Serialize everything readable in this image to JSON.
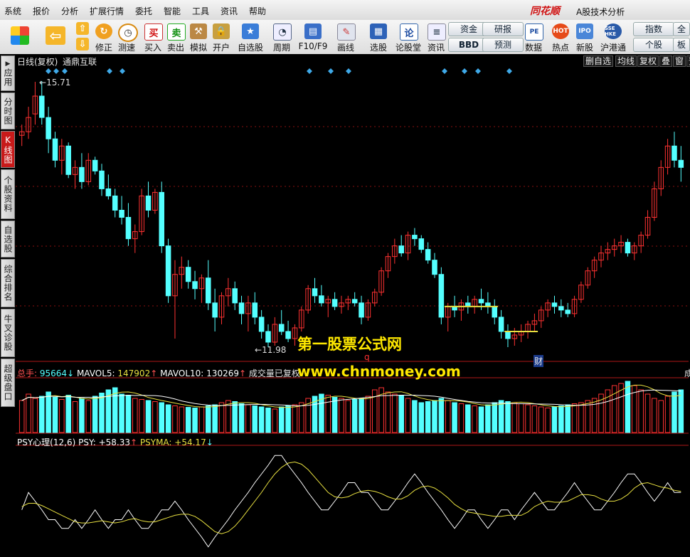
{
  "menu": {
    "items": [
      "系统",
      "报价",
      "分析",
      "扩展行情",
      "委托",
      "智能",
      "工具",
      "资讯",
      "帮助"
    ],
    "brand": "同花顺",
    "app_title": "A股技术分析"
  },
  "toolbar": {
    "buttons": [
      {
        "label": "修正",
        "icon": "up-arrow-icon"
      },
      {
        "label": "测速",
        "icon": "clock-icon"
      },
      {
        "label": "买入",
        "icon": "buy-icon"
      },
      {
        "label": "卖出",
        "icon": "sell-icon"
      },
      {
        "label": "模拟",
        "icon": "hammer-icon"
      },
      {
        "label": "开户",
        "icon": "lock-icon"
      },
      {
        "label": "自选股",
        "icon": "star-icon"
      },
      {
        "label": "周期",
        "icon": "period-icon"
      },
      {
        "label": "F10/F9",
        "icon": "f10-icon"
      },
      {
        "label": "画线",
        "icon": "pen-icon"
      },
      {
        "label": "选股",
        "icon": "screen-icon"
      },
      {
        "label": "论股堂",
        "icon": "forum-icon"
      },
      {
        "label": "资讯",
        "icon": "news-icon"
      },
      {
        "label": "数据",
        "icon": "pe-icon"
      },
      {
        "label": "热点",
        "icon": "hot-icon"
      },
      {
        "label": "新股",
        "icon": "ipo-icon"
      },
      {
        "label": "沪港通",
        "icon": "sse-hkex-icon"
      }
    ],
    "small": [
      {
        "label": "资金"
      },
      {
        "label": "BBD"
      },
      {
        "label": "研报"
      },
      {
        "label": "预测"
      },
      {
        "label": "指数"
      },
      {
        "label": "个股"
      },
      {
        "label": "全球"
      },
      {
        "label": "板块"
      }
    ]
  },
  "side_tabs": [
    "应用",
    "分时图",
    "K线图",
    "个股资料",
    "自选股",
    "综合排名",
    "牛叉诊股",
    "超级盘口"
  ],
  "chart_header": {
    "period": "日线(复权)",
    "stock_name": "通鼎互联",
    "right_buttons": [
      "删自选",
      "均线",
      "复权",
      "叠",
      "窗",
      "预"
    ]
  },
  "price": {
    "high_label": "15.71",
    "low_label": "11.98"
  },
  "markers": {
    "q": "q",
    "cai": "财"
  },
  "volume_panel": {
    "title": "总手:",
    "total": "95664",
    "total_arrow": "↓",
    "mavol5_label": "MAVOL5:",
    "mavol5": "147902",
    "mavol5_arrow": "↑",
    "mavol10_label": "MAVOL10:",
    "mavol10": "130269",
    "mavol10_arrow": "↑",
    "note": "成交量已复权",
    "right_label": "成"
  },
  "psy_panel": {
    "title": "PSY心理(12,6)",
    "psy_label": "PSY:",
    "psy": "+58.33",
    "psy_arrow": "↑",
    "psyma_label": "PSYMA:",
    "psyma": "+54.17",
    "psyma_arrow": "↓"
  },
  "watermark": {
    "line1": "第一股票公式网",
    "line2": "www.chnmoney.com"
  },
  "colors": {
    "up": "#ff3232",
    "down": "#54ffff",
    "ma_yellow": "#e8e040",
    "bg": "#000000",
    "grid": "#8a1010",
    "diamond": "#3fa9e8",
    "watermark": "#ffe800"
  },
  "chart_data": {
    "type": "candlestick",
    "price_range": [
      11.98,
      15.71
    ],
    "psy_range": [
      0,
      100
    ],
    "candles": [
      [
        14.95,
        15.1,
        14.8,
        15.0
      ],
      [
        15.0,
        15.35,
        14.9,
        15.2
      ],
      [
        15.25,
        15.7,
        15.1,
        15.5
      ],
      [
        15.5,
        15.71,
        15.1,
        15.2
      ],
      [
        15.2,
        15.35,
        14.7,
        14.9
      ],
      [
        14.9,
        15.0,
        14.5,
        14.6
      ],
      [
        14.6,
        14.9,
        14.4,
        14.8
      ],
      [
        14.8,
        14.85,
        14.35,
        14.4
      ],
      [
        14.4,
        14.6,
        14.2,
        14.5
      ],
      [
        14.5,
        14.7,
        14.2,
        14.3
      ],
      [
        14.3,
        14.7,
        14.25,
        14.6
      ],
      [
        14.6,
        14.65,
        14.4,
        14.45
      ],
      [
        14.45,
        14.55,
        14.1,
        14.2
      ],
      [
        14.2,
        14.4,
        14.05,
        14.1
      ],
      [
        14.1,
        14.2,
        13.8,
        13.9
      ],
      [
        13.9,
        14.1,
        13.7,
        13.8
      ],
      [
        13.8,
        14.0,
        13.4,
        13.5
      ],
      [
        13.5,
        13.7,
        13.3,
        13.6
      ],
      [
        13.6,
        14.2,
        13.55,
        14.1
      ],
      [
        14.1,
        14.3,
        13.8,
        13.9
      ],
      [
        13.9,
        14.2,
        13.85,
        14.15
      ],
      [
        14.15,
        14.3,
        13.3,
        13.4
      ],
      [
        13.4,
        13.5,
        12.6,
        12.7
      ],
      [
        12.7,
        13.2,
        12.1,
        13.0
      ],
      [
        13.0,
        13.25,
        12.8,
        13.1
      ],
      [
        13.1,
        13.2,
        12.8,
        12.9
      ],
      [
        12.9,
        13.05,
        12.65,
        12.8
      ],
      [
        12.8,
        13.0,
        12.6,
        12.95
      ],
      [
        12.95,
        13.2,
        12.5,
        12.6
      ],
      [
        12.6,
        12.8,
        12.2,
        12.4
      ],
      [
        12.4,
        12.75,
        12.3,
        12.7
      ],
      [
        12.7,
        12.95,
        12.55,
        12.8
      ],
      [
        12.8,
        12.9,
        12.5,
        12.6
      ],
      [
        12.6,
        12.7,
        12.3,
        12.45
      ],
      [
        12.45,
        12.7,
        12.2,
        12.6
      ],
      [
        12.6,
        12.75,
        12.3,
        12.4
      ],
      [
        12.4,
        12.5,
        12.1,
        12.2
      ],
      [
        12.2,
        12.3,
        11.98,
        12.05
      ],
      [
        12.05,
        12.4,
        12.0,
        12.3
      ],
      [
        12.3,
        12.5,
        12.15,
        12.2
      ],
      [
        12.2,
        12.35,
        12.05,
        12.1
      ],
      [
        12.1,
        12.3,
        12.0,
        12.25
      ],
      [
        12.25,
        12.55,
        12.2,
        12.5
      ],
      [
        12.5,
        12.85,
        12.45,
        12.8
      ],
      [
        12.8,
        12.95,
        12.6,
        12.7
      ],
      [
        12.7,
        12.85,
        12.55,
        12.6
      ],
      [
        12.6,
        12.7,
        12.4,
        12.65
      ],
      [
        12.65,
        12.75,
        12.5,
        12.55
      ],
      [
        12.55,
        12.7,
        12.45,
        12.6
      ],
      [
        12.6,
        12.7,
        12.5,
        12.65
      ],
      [
        12.65,
        12.75,
        12.55,
        12.6
      ],
      [
        12.6,
        12.7,
        12.3,
        12.4
      ],
      [
        12.4,
        12.65,
        12.35,
        12.6
      ],
      [
        12.6,
        12.8,
        12.55,
        12.75
      ],
      [
        12.75,
        13.1,
        12.7,
        13.05
      ],
      [
        13.05,
        13.3,
        12.95,
        13.25
      ],
      [
        13.25,
        13.5,
        13.15,
        13.4
      ],
      [
        13.4,
        13.55,
        13.25,
        13.3
      ],
      [
        13.3,
        13.6,
        13.2,
        13.55
      ],
      [
        13.55,
        13.65,
        13.4,
        13.5
      ],
      [
        13.5,
        13.55,
        13.3,
        13.35
      ],
      [
        13.35,
        13.45,
        13.15,
        13.2
      ],
      [
        13.2,
        13.3,
        12.95,
        13.0
      ],
      [
        13.0,
        13.1,
        12.3,
        12.4
      ],
      [
        12.4,
        12.6,
        12.2,
        12.55
      ],
      [
        12.55,
        12.7,
        12.4,
        12.5
      ],
      [
        12.5,
        12.65,
        12.35,
        12.6
      ],
      [
        12.6,
        12.7,
        12.45,
        12.55
      ],
      [
        12.55,
        12.7,
        12.45,
        12.65
      ],
      [
        12.65,
        12.8,
        12.5,
        12.6
      ],
      [
        12.6,
        12.75,
        12.45,
        12.55
      ],
      [
        12.55,
        12.65,
        12.3,
        12.4
      ],
      [
        12.4,
        12.5,
        12.1,
        12.2
      ],
      [
        12.2,
        12.3,
        11.98,
        12.1
      ],
      [
        12.1,
        12.25,
        12.0,
        12.15
      ],
      [
        12.15,
        12.3,
        12.05,
        12.2
      ],
      [
        12.2,
        12.35,
        12.1,
        12.3
      ],
      [
        12.3,
        12.45,
        12.2,
        12.35
      ],
      [
        12.35,
        12.55,
        12.25,
        12.5
      ],
      [
        12.5,
        12.65,
        12.4,
        12.6
      ],
      [
        12.6,
        12.7,
        12.45,
        12.55
      ],
      [
        12.55,
        12.65,
        12.4,
        12.5
      ],
      [
        12.5,
        12.6,
        12.4,
        12.45
      ],
      [
        12.45,
        12.7,
        12.4,
        12.65
      ],
      [
        12.65,
        12.9,
        12.6,
        12.85
      ],
      [
        12.85,
        13.1,
        12.8,
        13.05
      ],
      [
        13.05,
        13.25,
        12.95,
        13.2
      ],
      [
        13.2,
        13.4,
        13.1,
        13.3
      ],
      [
        13.3,
        13.45,
        13.2,
        13.35
      ],
      [
        13.35,
        13.5,
        13.25,
        13.4
      ],
      [
        13.4,
        13.55,
        13.3,
        13.45
      ],
      [
        13.45,
        13.5,
        13.25,
        13.3
      ],
      [
        13.3,
        13.45,
        13.2,
        13.4
      ],
      [
        13.4,
        13.6,
        13.3,
        13.55
      ],
      [
        13.55,
        13.9,
        13.5,
        13.8
      ],
      [
        13.8,
        14.3,
        13.75,
        14.2
      ],
      [
        14.2,
        14.6,
        14.1,
        14.5
      ],
      [
        14.5,
        14.9,
        14.4,
        14.8
      ],
      [
        14.8,
        15.0,
        14.5,
        14.6
      ],
      [
        14.6,
        14.8,
        14.3,
        14.5
      ]
    ],
    "volume": [
      150,
      180,
      160,
      170,
      190,
      165,
      155,
      175,
      145,
      160,
      150,
      170,
      185,
      200,
      210,
      180,
      175,
      160,
      155,
      150,
      145,
      140,
      130,
      125,
      120,
      118,
      115,
      120,
      125,
      130,
      140,
      150,
      145,
      135,
      130,
      125,
      120,
      115,
      110,
      120,
      125,
      130,
      140,
      160,
      170,
      180,
      175,
      165,
      160,
      150,
      155,
      160,
      170,
      200,
      210,
      190,
      180,
      175,
      160,
      150,
      140,
      145,
      150,
      160,
      150,
      140,
      135,
      130,
      125,
      120,
      130,
      140,
      150,
      145,
      140,
      135,
      130,
      125,
      120,
      115,
      120,
      125,
      130,
      135,
      140,
      150,
      160,
      180,
      200,
      220,
      230,
      240,
      220,
      200,
      180,
      160,
      150,
      170,
      190,
      200
    ],
    "psy": [
      42,
      58,
      50,
      42,
      33,
      33,
      25,
      25,
      33,
      25,
      33,
      42,
      33,
      25,
      33,
      33,
      42,
      33,
      25,
      25,
      33,
      42,
      42,
      50,
      42,
      33,
      25,
      17,
      8,
      17,
      25,
      33,
      42,
      50,
      58,
      67,
      75,
      83,
      92,
      92,
      83,
      75,
      67,
      58,
      50,
      42,
      42,
      50,
      58,
      67,
      67,
      58,
      58,
      50,
      42,
      42,
      50,
      58,
      67,
      75,
      67,
      58,
      50,
      42,
      33,
      25,
      33,
      42,
      42,
      33,
      25,
      33,
      42,
      42,
      33,
      42,
      50,
      58,
      50,
      42,
      42,
      50,
      58,
      67,
      58,
      50,
      42,
      42,
      50,
      58,
      67,
      75,
      75,
      67,
      58,
      50,
      58,
      67,
      58,
      58
    ],
    "psyma": [
      45,
      48,
      48,
      46,
      43,
      40,
      37,
      34,
      31,
      30,
      30,
      31,
      32,
      31,
      30,
      31,
      33,
      34,
      32,
      31,
      31,
      33,
      35,
      37,
      38,
      38,
      36,
      32,
      27,
      22,
      20,
      22,
      27,
      34,
      42,
      50,
      58,
      67,
      75,
      81,
      85,
      86,
      84,
      79,
      72,
      65,
      58,
      54,
      53,
      54,
      57,
      59,
      60,
      59,
      57,
      54,
      52,
      52,
      55,
      60,
      63,
      64,
      62,
      58,
      53,
      47,
      43,
      40,
      39,
      38,
      37,
      36,
      36,
      37,
      37,
      37,
      40,
      45,
      48,
      50,
      49,
      49,
      50,
      53,
      56,
      56,
      55,
      52,
      50,
      50,
      52,
      56,
      62,
      66,
      67,
      65,
      63,
      62,
      60,
      59
    ]
  }
}
